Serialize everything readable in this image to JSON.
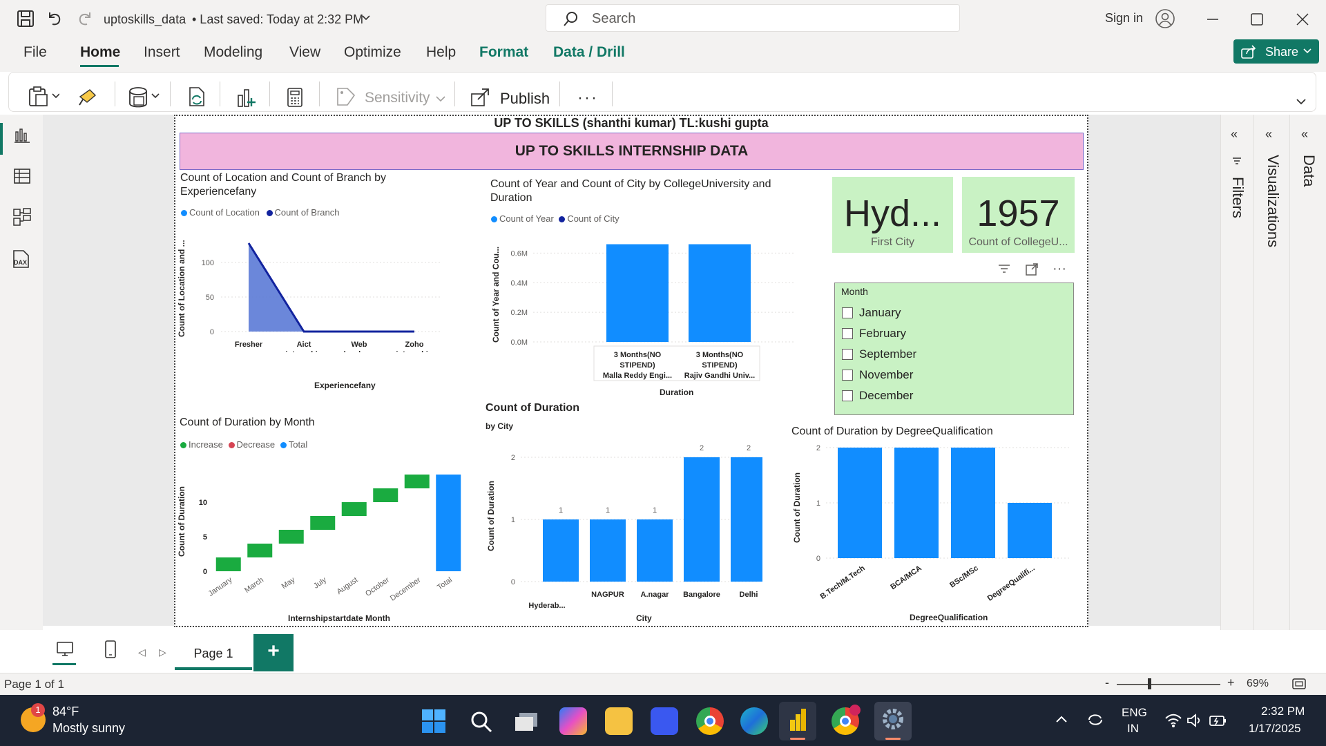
{
  "titlebar": {
    "file_name": "uptoskills_data",
    "saved": "• Last saved: Today at 2:32 PM",
    "search_placeholder": "Search",
    "sign_in": "Sign in"
  },
  "menu": [
    "File",
    "Home",
    "Insert",
    "Modeling",
    "View",
    "Optimize",
    "Help",
    "Format",
    "Data / Drill"
  ],
  "share_label": "Share",
  "ribbon": {
    "sensitivity": "Sensitivity",
    "publish": "Publish"
  },
  "report": {
    "top_title": "UP TO SKILLS (shanthi kumar) TL:kushi gupta",
    "banner": "UP TO SKILLS INTERNSHIP DATA",
    "area": {
      "title": "Count of Location and Count of Branch by Experiencefany",
      "legend": [
        "Count of Location",
        "Count of Branch"
      ],
      "ylabel": "Count of Location and ...",
      "xlabel": "Experiencefany",
      "yticks": [
        "100",
        "50",
        "0"
      ],
      "cats": [
        "Fresher",
        "Aict internship",
        "Web developer intern SR...",
        "Zoho internship"
      ]
    },
    "college": {
      "title": "Count of Year and Count of City by CollegeUniversity and Duration",
      "legend": [
        "Count of Year",
        "Count of City"
      ],
      "ylabel": "Count of Year and Cou...",
      "xlabel": "Duration",
      "yticks": [
        "0.6M",
        "0.4M",
        "0.2M",
        "0.0M"
      ],
      "cats": [
        "3 Months(NO STIPEND)",
        "3 Months(NO STIPEND)"
      ],
      "subcats": [
        "Malla Reddy Engi...",
        "Rajiv Gandhi Univ..."
      ]
    },
    "card1": {
      "value": "Hyd...",
      "label": "First City"
    },
    "card2": {
      "value": "1957",
      "label": "Count of CollegeU..."
    },
    "slicer": {
      "title": "Month",
      "items": [
        "January",
        "February",
        "September",
        "November",
        "December"
      ]
    },
    "waterfall": {
      "title": "Count of Duration by Month",
      "legend": [
        "Increase",
        "Decrease",
        "Total"
      ],
      "ylabel": "Count of Duration",
      "xlabel": "Internshipstartdate Month",
      "yticks": [
        "10",
        "5",
        "0"
      ],
      "cats": [
        "January",
        "March",
        "May",
        "July",
        "August",
        "October",
        "December",
        "Total"
      ]
    },
    "city": {
      "title": "Count of Duration",
      "subtitle": "by City",
      "ylabel": "Count of Duration",
      "xlabel": "City",
      "yticks": [
        "2",
        "1",
        "0"
      ],
      "cats": [
        "Hyderab...",
        "NAGPUR",
        "A.nagar",
        "Bangalore",
        "Delhi"
      ],
      "labels": [
        "1",
        "1",
        "1",
        "2",
        "2"
      ]
    },
    "degree": {
      "title": "Count of Duration by DegreeQualification",
      "ylabel": "Count of Duration",
      "xlabel": "DegreeQualification",
      "yticks": [
        "2",
        "1",
        "0"
      ],
      "cats": [
        "B.Tech/M.Tech",
        "BCA/MCA",
        "BSc/MSc",
        "DegreeQualifi..."
      ]
    }
  },
  "panes": {
    "filters": "Filters",
    "visualizations": "Visualizations",
    "data": "Data"
  },
  "pages": {
    "page1": "Page 1",
    "status": "Page 1 of 1",
    "zoom": "69%"
  },
  "taskbar": {
    "temp": "84°F",
    "weather": "Mostly sunny",
    "badge": "1",
    "lang1": "ENG",
    "lang2": "IN",
    "time": "2:32 PM",
    "date": "1/17/2025"
  },
  "colors": {
    "accent": "#117865",
    "bar": "#118dff",
    "navy": "#12239e",
    "increase": "#1aab40",
    "decrease": "#d64554",
    "banner": "#f1b5dd",
    "card": "#c9f2c4"
  },
  "chart_data": [
    {
      "type": "area",
      "categories": [
        "Fresher",
        "Aict internship",
        "Web developer intern SR...",
        "Zoho internship"
      ],
      "series": [
        {
          "name": "Count of Location",
          "values": [
            128,
            0,
            0,
            0
          ]
        },
        {
          "name": "Count of Branch",
          "values": [
            128,
            0,
            0,
            0
          ]
        }
      ],
      "ylim": [
        0,
        140
      ]
    },
    {
      "type": "bar",
      "categories": [
        "Malla Reddy Engi...",
        "Rajiv Gandhi Univ..."
      ],
      "series": [
        {
          "name": "Count of Year",
          "values": [
            660000,
            660000
          ]
        }
      ],
      "ylim": [
        0,
        700000
      ]
    },
    {
      "type": "bar",
      "categories": [
        "January",
        "March",
        "May",
        "July",
        "August",
        "October",
        "December",
        "Total"
      ],
      "values": [
        2,
        2,
        2,
        2,
        2,
        2,
        2,
        14
      ],
      "ylim": [
        0,
        15
      ]
    },
    {
      "type": "bar",
      "categories": [
        "Hyderab...",
        "NAGPUR",
        "A.nagar",
        "Bangalore",
        "Delhi"
      ],
      "values": [
        1,
        1,
        1,
        2,
        2
      ],
      "ylim": [
        0,
        2
      ]
    },
    {
      "type": "bar",
      "categories": [
        "B.Tech/M.Tech",
        "BCA/MCA",
        "BSc/MSc",
        "DegreeQualifi..."
      ],
      "values": [
        2,
        2,
        2,
        1
      ],
      "ylim": [
        0,
        2
      ]
    }
  ]
}
